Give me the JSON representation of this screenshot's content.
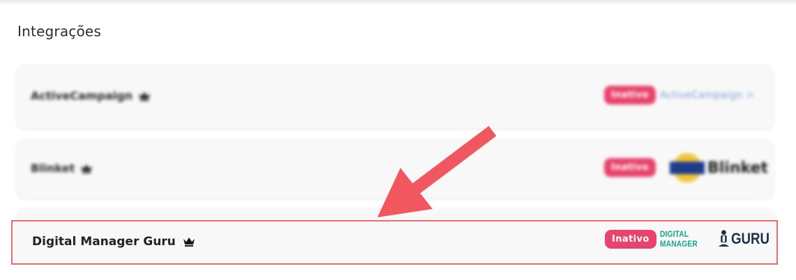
{
  "section_title": "Integrações",
  "integrations": [
    {
      "name": "ActiveCampaign",
      "status": "Inativo",
      "logo_text": "ActiveCampaign >"
    },
    {
      "name": "Blinket",
      "status": "Inativo",
      "logo_text": "Blinket"
    },
    {
      "name": "Digital Manager Guru",
      "status": "Inativo",
      "logo_prefix": "DIGITAL MANAGER",
      "logo_word": "GURU"
    }
  ],
  "colors": {
    "badge": "#e8436c",
    "highlight_border": "#ee6b70",
    "arrow": "#f0575e",
    "guru_green": "#14a689",
    "guru_navy": "#1e3049"
  },
  "icons": [
    "crown-icon",
    "arrow-annotation"
  ]
}
